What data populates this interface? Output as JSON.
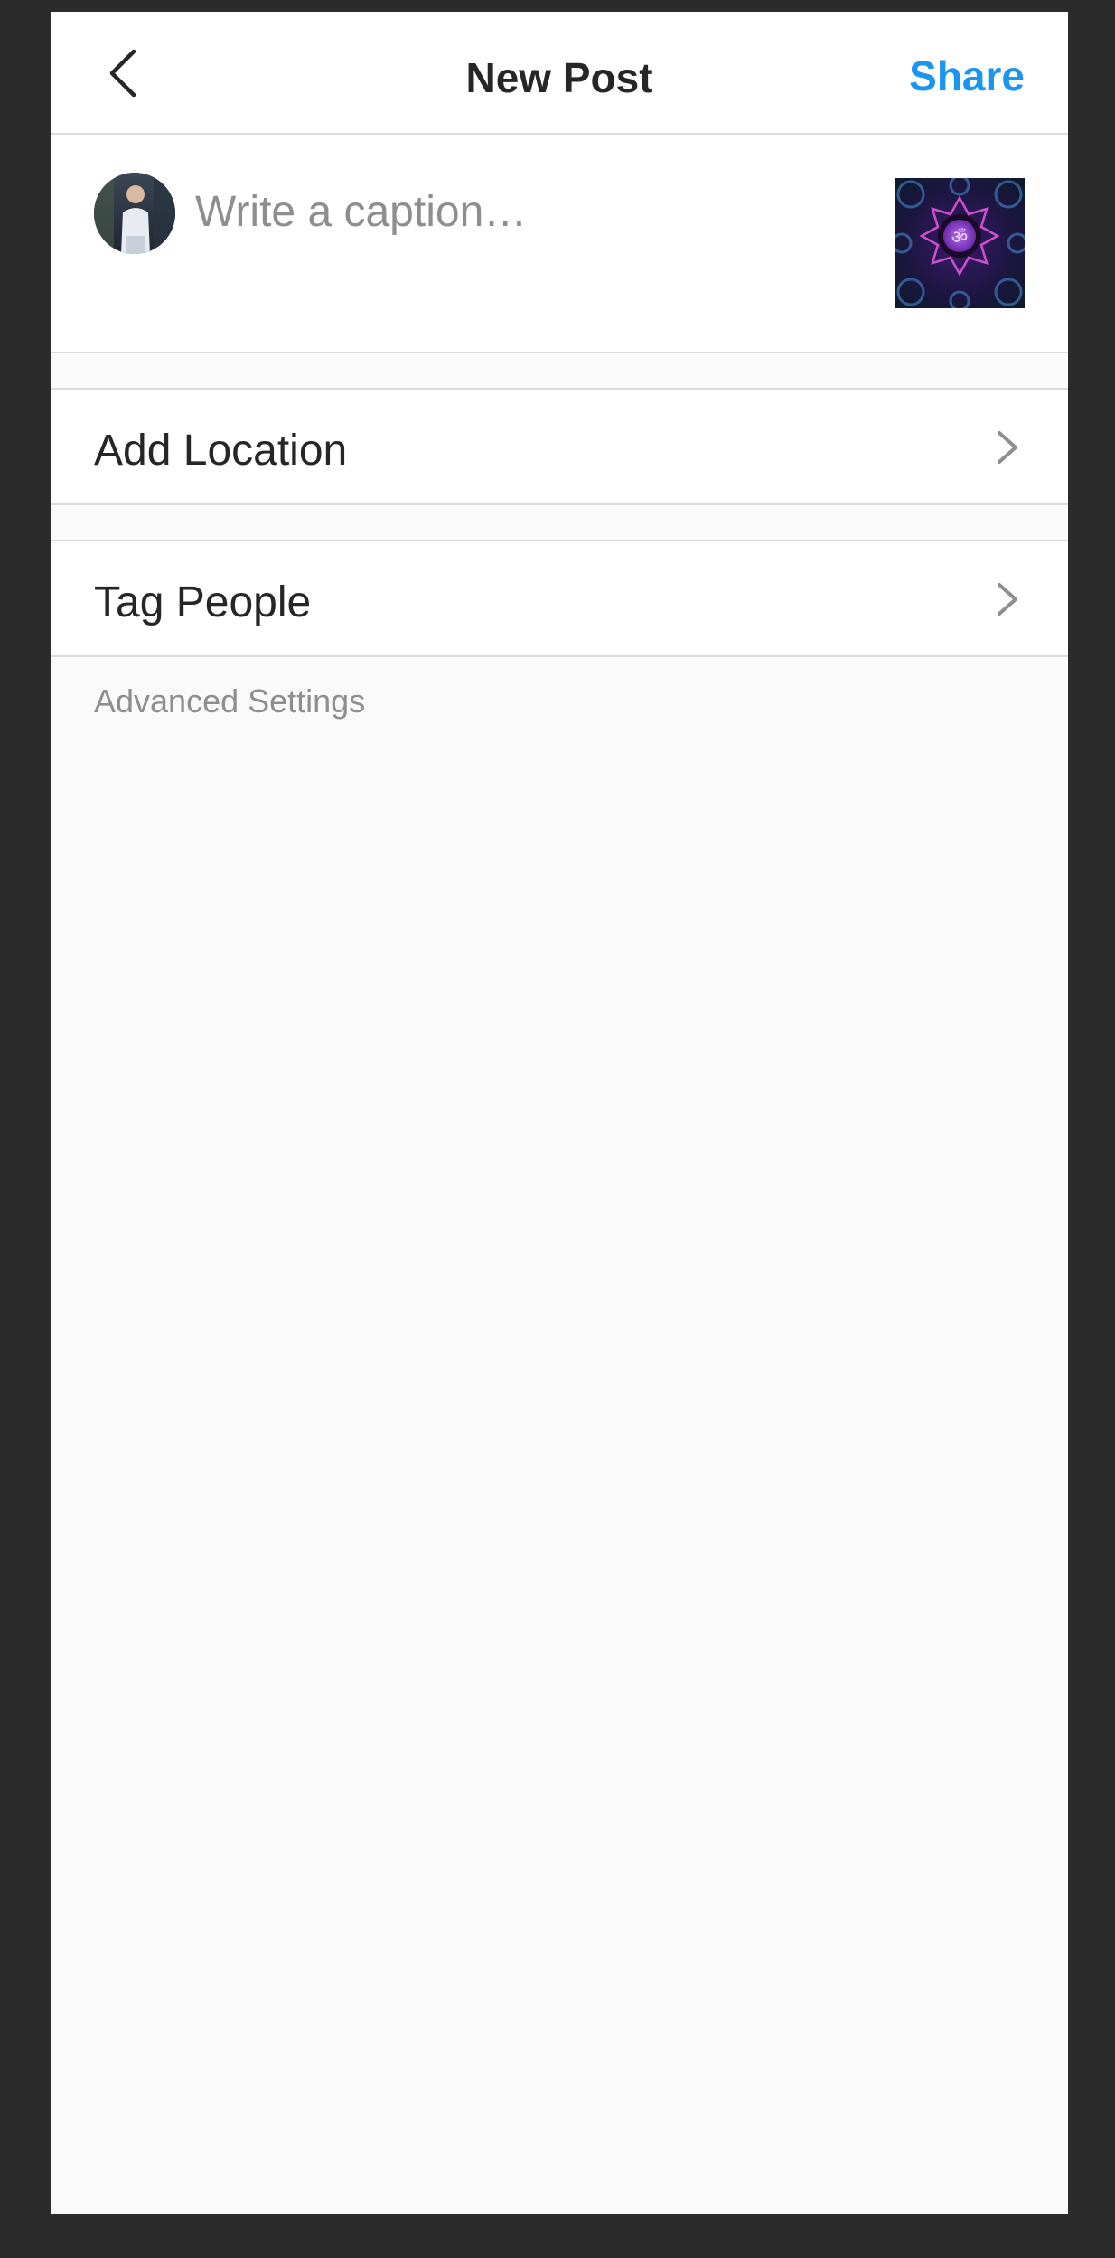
{
  "header": {
    "title": "New Post",
    "share_label": "Share",
    "back_icon": "chevron-left-icon",
    "accent_color": "#1a95f0"
  },
  "caption": {
    "placeholder": "Write a caption…",
    "value": ""
  },
  "options": [
    {
      "label": "Add Location",
      "icon": "chevron-right-icon"
    },
    {
      "label": "Tag People",
      "icon": "chevron-right-icon"
    }
  ],
  "advanced_settings_label": "Advanced Settings"
}
